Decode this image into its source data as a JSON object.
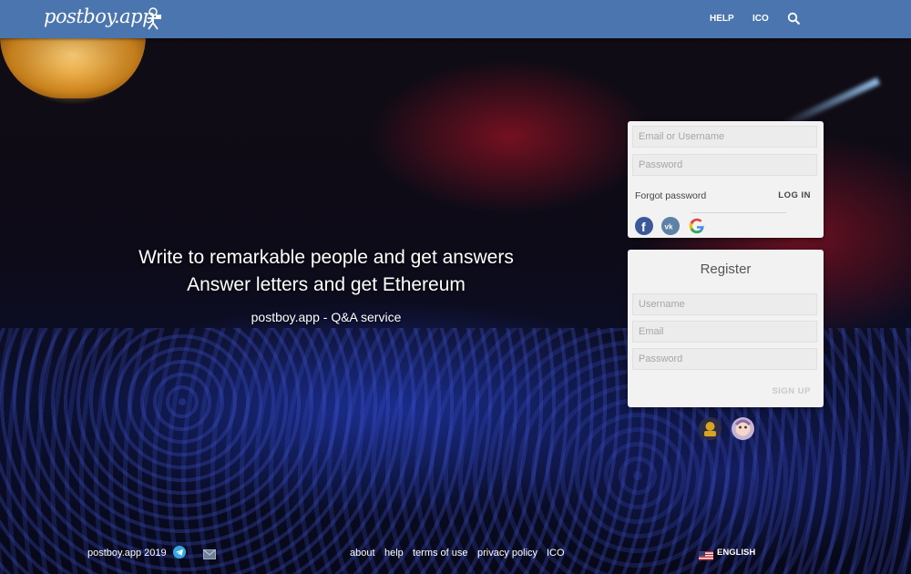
{
  "header": {
    "logo_text": "postboy.app",
    "nav": {
      "help": "HELP",
      "ico": "ICO"
    },
    "brand_color": "#4b75ae"
  },
  "hero": {
    "line1": "Write to remarkable people and get answers",
    "line2": "Answer letters and get Ethereum",
    "tagline": "postboy.app - Q&A service"
  },
  "login": {
    "email_placeholder": "Email or Username",
    "password_placeholder": "Password",
    "forgot_label": "Forgot password",
    "login_label": "LOG IN",
    "social_icons": [
      "facebook-icon",
      "vk-icon",
      "google-icon"
    ]
  },
  "register": {
    "title": "Register",
    "username_placeholder": "Username",
    "email_placeholder": "Email",
    "password_placeholder": "Password",
    "signup_label": "SIGN UP"
  },
  "footer": {
    "copyright": "postboy.app 2019",
    "links": {
      "about": "about",
      "help": "help",
      "terms": "terms of use",
      "privacy": "privacy policy",
      "ico": "ICO"
    },
    "language": "ENGLISH",
    "language_flag": "us-flag-icon"
  }
}
